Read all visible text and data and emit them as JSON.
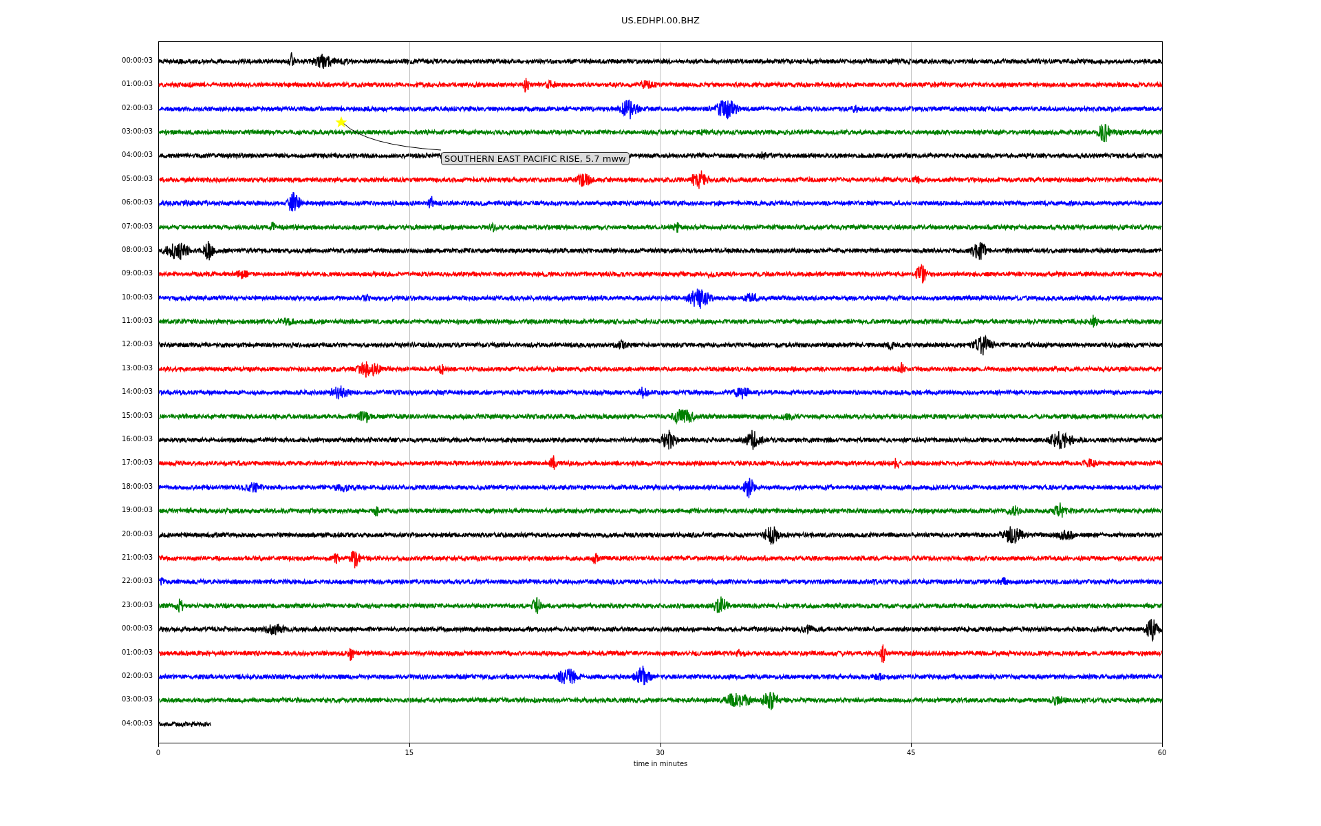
{
  "title": "US.EDHPI.00.BHZ",
  "traces": [
    {
      "label": "00:00:03",
      "color": "#000000",
      "partial": false
    },
    {
      "label": "01:00:03",
      "color": "#ff0000",
      "partial": false
    },
    {
      "label": "02:00:03",
      "color": "#0000ff",
      "partial": false
    },
    {
      "label": "03:00:03",
      "color": "#008000",
      "partial": false
    },
    {
      "label": "04:00:03",
      "color": "#000000",
      "partial": false
    },
    {
      "label": "05:00:03",
      "color": "#ff0000",
      "partial": false
    },
    {
      "label": "06:00:03",
      "color": "#0000ff",
      "partial": false
    },
    {
      "label": "07:00:03",
      "color": "#008000",
      "partial": false
    },
    {
      "label": "08:00:03",
      "color": "#000000",
      "partial": false
    },
    {
      "label": "09:00:03",
      "color": "#ff0000",
      "partial": false
    },
    {
      "label": "10:00:03",
      "color": "#0000ff",
      "partial": false
    },
    {
      "label": "11:00:03",
      "color": "#008000",
      "partial": false
    },
    {
      "label": "12:00:03",
      "color": "#000000",
      "partial": false
    },
    {
      "label": "13:00:03",
      "color": "#ff0000",
      "partial": false
    },
    {
      "label": "14:00:03",
      "color": "#0000ff",
      "partial": false
    },
    {
      "label": "15:00:03",
      "color": "#008000",
      "partial": false
    },
    {
      "label": "16:00:03",
      "color": "#000000",
      "partial": false
    },
    {
      "label": "17:00:03",
      "color": "#ff0000",
      "partial": false
    },
    {
      "label": "18:00:03",
      "color": "#0000ff",
      "partial": false
    },
    {
      "label": "19:00:03",
      "color": "#008000",
      "partial": false
    },
    {
      "label": "20:00:03",
      "color": "#000000",
      "partial": false
    },
    {
      "label": "21:00:03",
      "color": "#ff0000",
      "partial": false
    },
    {
      "label": "22:00:03",
      "color": "#0000ff",
      "partial": false
    },
    {
      "label": "23:00:03",
      "color": "#008000",
      "partial": false
    },
    {
      "label": "00:00:03",
      "color": "#000000",
      "partial": false
    },
    {
      "label": "01:00:03",
      "color": "#ff0000",
      "partial": false
    },
    {
      "label": "02:00:03",
      "color": "#0000ff",
      "partial": false
    },
    {
      "label": "03:00:03",
      "color": "#008000",
      "partial": false
    },
    {
      "label": "04:00:03",
      "color": "#000000",
      "partial": true
    }
  ],
  "event": {
    "text": "SOUTHERN EAST PACIFIC RISE, 5.7 mww"
  },
  "x_axis": {
    "ticks": [
      "0",
      "15",
      "30",
      "45",
      "60"
    ],
    "label": "time in minutes"
  }
}
